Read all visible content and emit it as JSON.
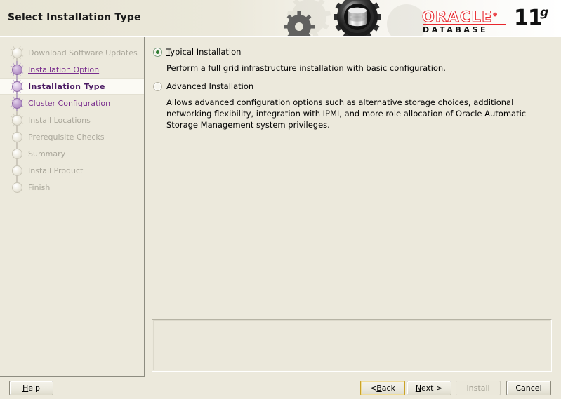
{
  "window": {
    "title": "Select Installation Type",
    "product_logo": {
      "brand": "ORACLE",
      "registered": "®",
      "product": "DATABASE",
      "version_number": "11",
      "version_suffix": "g",
      "brand_color": "#e8262c",
      "text_color": "#111111"
    }
  },
  "sidebar": {
    "steps": [
      {
        "label": "Download Software Updates",
        "state": "todo"
      },
      {
        "label": "Installation Option",
        "state": "done"
      },
      {
        "label": "Installation Type",
        "state": "current"
      },
      {
        "label": "Cluster Configuration",
        "state": "done"
      },
      {
        "label": "Install Locations",
        "state": "todo"
      },
      {
        "label": "Prerequisite Checks",
        "state": "todo"
      },
      {
        "label": "Summary",
        "state": "todo"
      },
      {
        "label": "Install Product",
        "state": "todo"
      },
      {
        "label": "Finish",
        "state": "todo"
      }
    ],
    "link_color": "#7a2f8e",
    "current_color": "#4b1a63",
    "todo_color": "#a9a69a"
  },
  "main": {
    "options": [
      {
        "label_prefix": "",
        "mnemonic": "T",
        "label_suffix": "ypical Installation",
        "selected": true,
        "description": "Perform a full grid infrastructure installation with basic configuration."
      },
      {
        "label_prefix": "",
        "mnemonic": "A",
        "label_suffix": "dvanced Installation",
        "selected": false,
        "description": "Allows advanced configuration options such as alternative storage choices, additional networking flexibility, integration with IPMI, and more role allocation of Oracle Automatic Storage Management system privileges."
      }
    ],
    "message_panel_text": ""
  },
  "buttons": {
    "help": {
      "mnemonic": "H",
      "suffix": "elp",
      "enabled": true,
      "focused": false
    },
    "back": {
      "prefix": "< ",
      "mnemonic": "B",
      "suffix": "ack",
      "enabled": true,
      "focused": true
    },
    "next": {
      "prefix": "",
      "mnemonic": "N",
      "suffix": "ext >",
      "enabled": true,
      "focused": false
    },
    "install": {
      "label": "Install",
      "enabled": false,
      "focused": false
    },
    "cancel": {
      "label": "Cancel",
      "enabled": true,
      "focused": false
    }
  }
}
